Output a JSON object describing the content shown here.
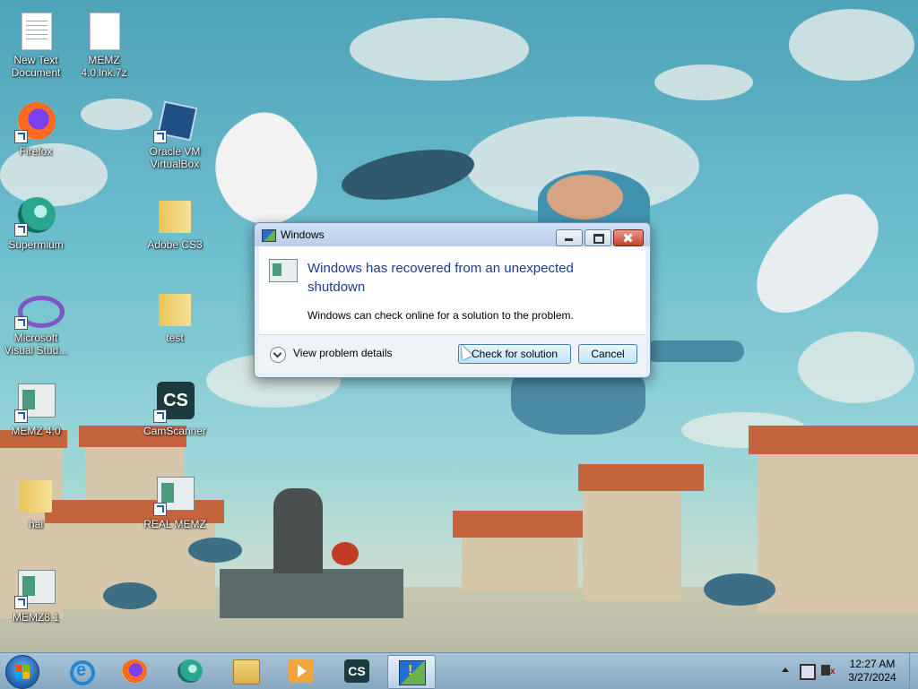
{
  "desktop": {
    "icons": [
      {
        "label": "New Text\nDocument",
        "icon": "text-document-icon"
      },
      {
        "label": "MEMZ\n4.0.lnk.7z",
        "icon": "file-icon"
      },
      {
        "label": "Firefox",
        "icon": "firefox-icon"
      },
      {
        "label": "Oracle VM\nVirtualBox",
        "icon": "virtualbox-icon"
      },
      {
        "label": "Supermium",
        "icon": "supermium-icon"
      },
      {
        "label": "Adobe CS3",
        "icon": "folder-icon"
      },
      {
        "label": "Microsoft\nVisual Stud...",
        "icon": "visual-studio-icon"
      },
      {
        "label": "test",
        "icon": "folder-icon"
      },
      {
        "label": "MEMZ 4.0",
        "icon": "memz-app-icon"
      },
      {
        "label": "CamScanner",
        "icon": "camscanner-icon"
      },
      {
        "label": "hai",
        "icon": "folder-icon"
      },
      {
        "label": "REAL MEMZ",
        "icon": "memz-app-icon"
      },
      {
        "label": "MEMZ8.1",
        "icon": "memz-app-icon"
      }
    ]
  },
  "dialog": {
    "title": "Windows",
    "headline": "Windows has recovered from an unexpected shutdown",
    "subtext": "Windows can check online for a solution to the problem.",
    "details_label": "View problem details",
    "check_label": "Check for solution",
    "cancel_label": "Cancel"
  },
  "taskbar": {
    "cs_text": "CS",
    "clock_time": "12:27 AM",
    "clock_date": "3/27/2024",
    "pinned": [
      "internet-explorer-icon",
      "firefox-icon",
      "supermium-icon",
      "file-explorer-icon",
      "media-player-icon",
      "camscanner-icon",
      "action-center-icon"
    ]
  },
  "icon_texts": {
    "cs": "CS"
  }
}
